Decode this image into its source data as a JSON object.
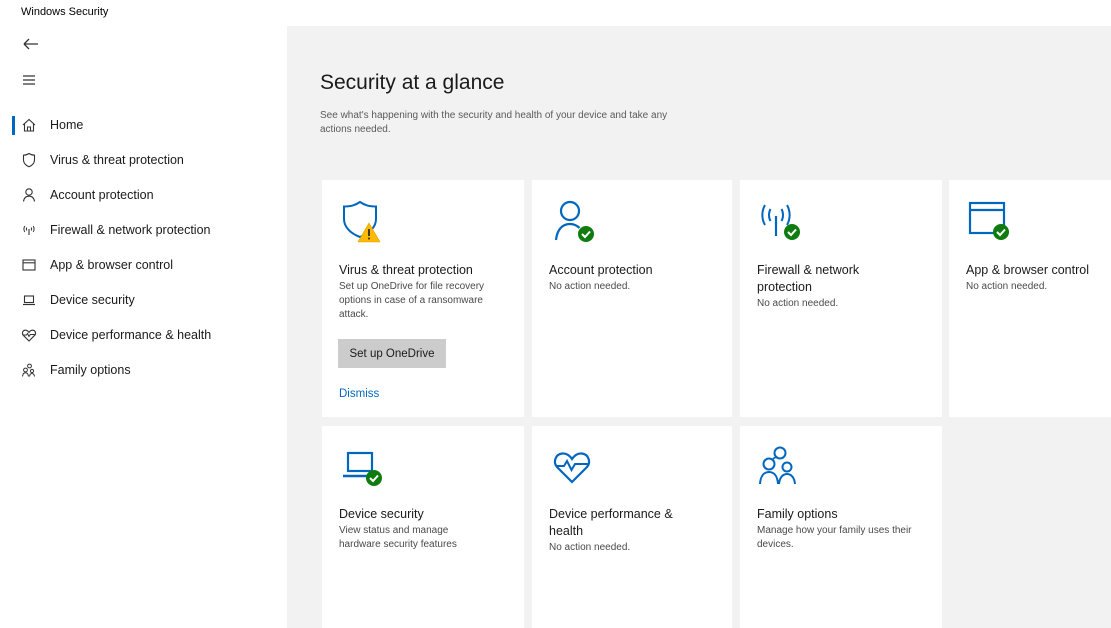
{
  "window": {
    "title": "Windows Security"
  },
  "sidebar": {
    "back_icon": "back-arrow-icon",
    "menu_icon": "hamburger-menu-icon",
    "items": [
      {
        "label": "Home",
        "icon": "home-icon",
        "selected": true
      },
      {
        "label": "Virus & threat protection",
        "icon": "shield-icon",
        "selected": false
      },
      {
        "label": "Account protection",
        "icon": "person-icon",
        "selected": false
      },
      {
        "label": "Firewall & network protection",
        "icon": "wireless-signal-icon",
        "selected": false
      },
      {
        "label": "App & browser control",
        "icon": "app-window-icon",
        "selected": false
      },
      {
        "label": "Device security",
        "icon": "laptop-icon",
        "selected": false
      },
      {
        "label": "Device performance & health",
        "icon": "heart-pulse-icon",
        "selected": false
      },
      {
        "label": "Family options",
        "icon": "family-icon",
        "selected": false
      }
    ]
  },
  "main": {
    "title": "Security at a glance",
    "subtitle": "See what's happening with the security and health of your device and take any actions needed.",
    "cards": [
      {
        "title": "Virus & threat protection",
        "description": "Set up OneDrive for file recovery options in case of a ransomware attack.",
        "icon": "shield-warning-icon",
        "status": "warning"
      },
      {
        "title": "Account protection",
        "description": "No action needed.",
        "icon": "person-check-icon",
        "status": "ok"
      },
      {
        "title": "Firewall & network protection",
        "description": "No action needed.",
        "icon": "wireless-check-icon",
        "status": "ok"
      },
      {
        "title": "App & browser control",
        "description": "No action needed.",
        "icon": "app-window-check-icon",
        "status": "ok"
      },
      {
        "title": "Device security",
        "description": "View status and manage hardware security features",
        "icon": "laptop-check-icon",
        "status": "ok"
      },
      {
        "title": "Device performance & health",
        "description": "No action needed.",
        "icon": "heart-pulse-icon",
        "status": "none"
      },
      {
        "title": "Family options",
        "description": "Manage how your family uses their devices.",
        "icon": "family-icon",
        "status": "none"
      }
    ],
    "onedrive_button": "Set up OneDrive",
    "dismiss_link": "Dismiss"
  },
  "colors": {
    "accent": "#0067c0",
    "ok": "#107c10",
    "warning": "#ffb900",
    "content_bg": "#f2f2f2"
  }
}
